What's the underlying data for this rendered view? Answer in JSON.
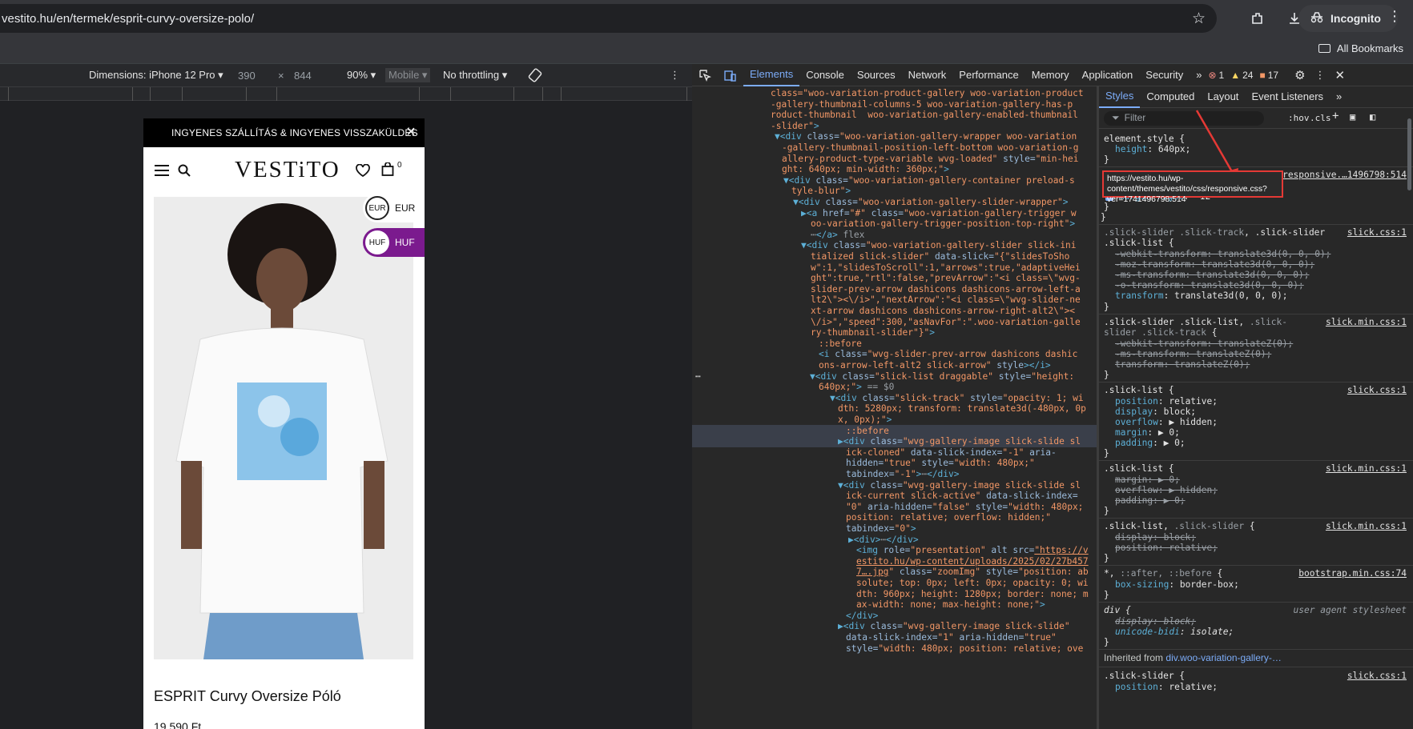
{
  "browser": {
    "url": "vestito.hu/en/termek/esprit-curvy-oversize-polo/",
    "incognito_label": "Incognito",
    "all_bookmarks": "All Bookmarks"
  },
  "device_toolbar": {
    "dimensions": "Dimensions: iPhone 12 Pro",
    "width": "390",
    "times": "×",
    "height": "844",
    "zoom": "90%",
    "mode": "Mobile",
    "throttling": "No throttling"
  },
  "page": {
    "promo": "INGYENES SZÁLLÍTÁS & INGYENES VISSZAKÜLDÉS",
    "logo": "VESTiTO",
    "cart_count": "0",
    "currencies": [
      {
        "code": "EUR",
        "label": "EUR"
      },
      {
        "code": "HUF",
        "label": "HUF"
      }
    ],
    "product_title": "ESPRIT Curvy Oversize Póló",
    "product_price": "19 590 Ft"
  },
  "devtools": {
    "tabs": [
      "Elements",
      "Console",
      "Sources",
      "Network",
      "Performance",
      "Memory",
      "Application",
      "Security"
    ],
    "errors": "1",
    "warnings": "24",
    "issues": "17",
    "styles_tabs": [
      "Styles",
      "Computed",
      "Layout",
      "Event Listeners"
    ],
    "filter_placeholder": "Filter",
    "hov": ":hov",
    "cls": ".cls",
    "tooltip": "https://vestito.hu/wp-content/themes/vestito/css/responsive.css?ver=1741496798:514",
    "inherited_from": "Inherited from",
    "inherited_selector": "div.woo-variation-gallery-…"
  }
}
